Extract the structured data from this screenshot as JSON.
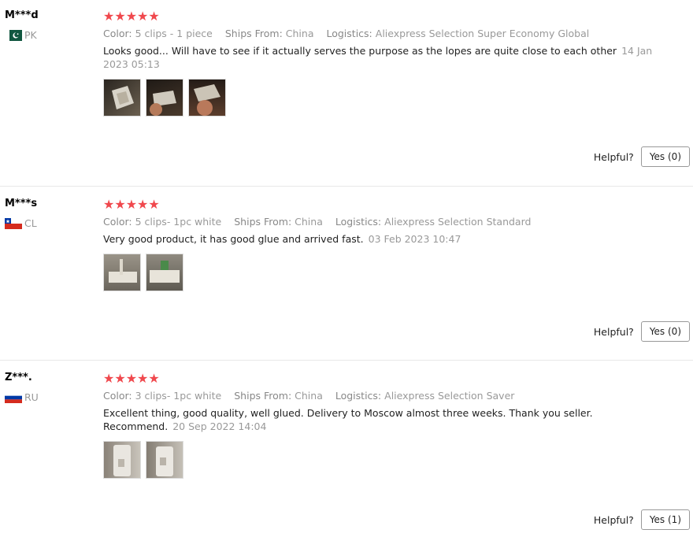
{
  "reviews": [
    {
      "user": "M***d",
      "country": "PK",
      "stars": "★★★★★",
      "color_label": "Color:",
      "color_value": "5 clips - 1 piece",
      "ships_label": "Ships From:",
      "ships_value": "China",
      "logistics_label": "Logistics:",
      "logistics_value": "Aliexpress Selection Super Economy Global",
      "text": "Looks good... Will have to see if it actually serves the purpose as the lopes are quite close to each other",
      "date": "14 Jan 2023 05:13",
      "helpful_label": "Helpful?",
      "helpful_button": "Yes (0)"
    },
    {
      "user": "M***s",
      "country": "CL",
      "stars": "★★★★★",
      "color_label": "Color:",
      "color_value": "5 clips- 1pc white",
      "ships_label": "Ships From:",
      "ships_value": "China",
      "logistics_label": "Logistics:",
      "logistics_value": "Aliexpress Selection Standard",
      "text": "Very good product, it has good glue and arrived fast.",
      "date": "03 Feb 2023 10:47",
      "helpful_label": "Helpful?",
      "helpful_button": "Yes (0)"
    },
    {
      "user": "Z***.",
      "country": "RU",
      "stars": "★★★★★",
      "color_label": "Color:",
      "color_value": "3 clips- 1pc white",
      "ships_label": "Ships From:",
      "ships_value": "China",
      "logistics_label": "Logistics:",
      "logistics_value": "Aliexpress Selection Saver",
      "text": "Excellent thing, good quality, well glued. Delivery to Moscow almost three weeks. Thank you seller. Recommend.",
      "date": "20 Sep 2022 14:04",
      "helpful_label": "Helpful?",
      "helpful_button": "Yes (1)"
    }
  ],
  "colors": {
    "star": "#f0484d",
    "meta": "#999999",
    "border": "#e8e8e8"
  }
}
